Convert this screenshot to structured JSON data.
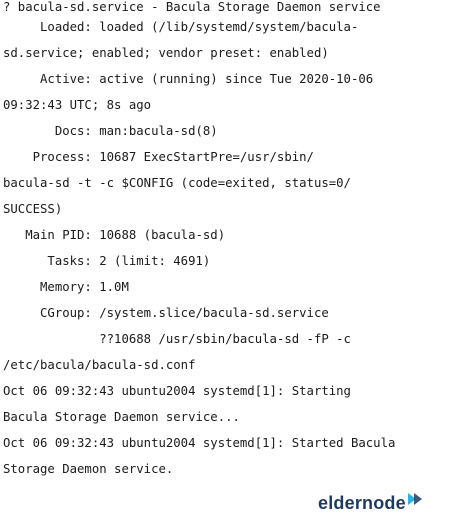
{
  "terminal": {
    "lines": [
      "? bacula-sd.service - Bacula Storage Daemon service",
      "     Loaded: loaded (/lib/systemd/system/bacula-",
      "sd.service; enabled; vendor preset: enabled)",
      "     Active: active (running) since Tue 2020-10-06",
      "09:32:43 UTC; 8s ago",
      "       Docs: man:bacula-sd(8)",
      "    Process: 10687 ExecStartPre=/usr/sbin/",
      "bacula-sd -t -c $CONFIG (code=exited, status=0/",
      "SUCCESS)",
      "   Main PID: 10688 (bacula-sd)",
      "      Tasks: 2 (limit: 4691)",
      "     Memory: 1.0M",
      "     CGroup: /system.slice/bacula-sd.service",
      "             ??10688 /usr/sbin/bacula-sd -fP -c",
      "/etc/bacula/bacula-sd.conf",
      "Oct 06 09:32:43 ubuntu2004 systemd[1]: Starting",
      "Bacula Storage Daemon service...",
      "Oct 06 09:32:43 ubuntu2004 systemd[1]: Started Bacula",
      "Storage Daemon service."
    ]
  },
  "watermark": {
    "logo_text": "eldernode",
    "logo_color": "#1f3a5f",
    "arrow_colors": [
      "#2bb3e6",
      "#1f3a5f"
    ]
  }
}
